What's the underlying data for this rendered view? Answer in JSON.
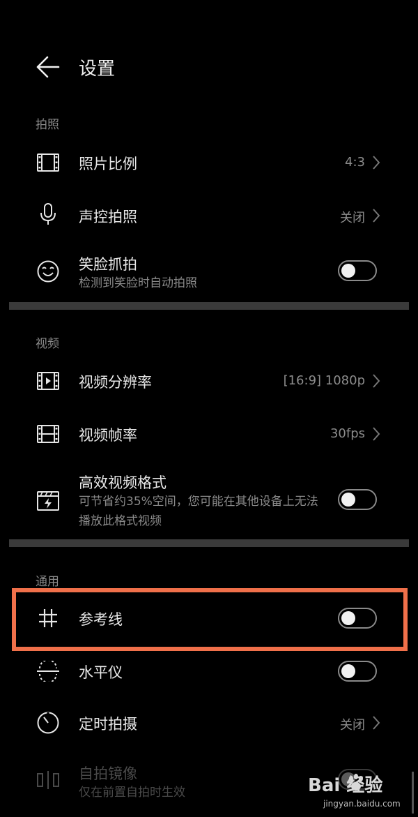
{
  "header": {
    "title": "设置"
  },
  "sections": {
    "photo": {
      "label": "拍照"
    },
    "video": {
      "label": "视频"
    },
    "general": {
      "label": "通用"
    }
  },
  "rows": {
    "photo_ratio": {
      "title": "照片比例",
      "value": "4:3",
      "icon": "aspect-ratio-icon"
    },
    "voice_capture": {
      "title": "声控拍照",
      "value": "关闭",
      "icon": "microphone-icon"
    },
    "smile_capture": {
      "title": "笑脸抓拍",
      "subtitle": "检测到笑脸时自动拍照",
      "toggle": false,
      "icon": "smile-icon"
    },
    "video_resolution": {
      "title": "视频分辨率",
      "value": "[16:9] 1080p",
      "icon": "video-resolution-icon"
    },
    "frame_rate": {
      "title": "视频帧率",
      "value": "30fps",
      "icon": "film-icon"
    },
    "efficient_format": {
      "title": "高效视频格式",
      "subtitle": "可节省约35%空间，您可能在其他设备上无法播放此格式视频",
      "toggle": false,
      "icon": "video-format-icon"
    },
    "gridlines": {
      "title": "参考线",
      "toggle": false,
      "icon": "grid-icon"
    },
    "level": {
      "title": "水平仪",
      "toggle": false,
      "icon": "level-icon"
    },
    "timer": {
      "title": "定时拍摄",
      "value": "关闭",
      "icon": "timer-icon"
    },
    "mirror": {
      "title": "自拍镜像",
      "subtitle": "仅在前置自拍时生效",
      "toggle": false,
      "icon": "mirror-icon",
      "disabled": true
    }
  },
  "watermark": {
    "brand": "Bai 经验",
    "site": "jingyan.baidu.com"
  },
  "colors": {
    "background": "#000000",
    "highlight": "#f0704a",
    "divider": "#3a3a3a"
  }
}
